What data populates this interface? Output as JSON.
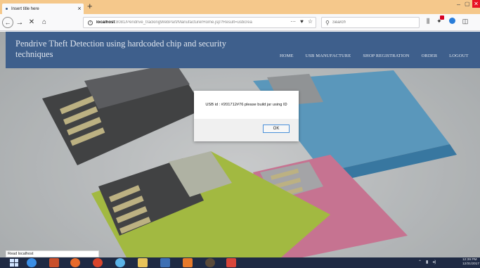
{
  "browser": {
    "tab_title": "Insert title here",
    "tab_close": "×",
    "new_tab": "+",
    "url_host": "localhost",
    "url_rest": ":8081/Pendrive_trackingWebPart/ManufacturerHome.jsp?Result=usbcrea",
    "search_placeholder": "Search",
    "page_actions": "···",
    "window_min": "–",
    "window_max": "▢",
    "window_close": "✕"
  },
  "site": {
    "title": "Pendrive Theft Detection using hardcoded chip and security techniques",
    "nav": [
      "HOME",
      "USB MANUFACTURE",
      "SHOP REGISTRATION",
      "ORDER",
      "LOGOUT"
    ]
  },
  "dialog": {
    "message": "USB id : #201712#76 please build jar using ID",
    "ok_label": "OK"
  },
  "status_text": "Read localhost",
  "taskbar": {
    "clock_time": "12:39 PM",
    "clock_date": "12/31/2017"
  },
  "colors": {
    "header_bg": "#3e5f8c",
    "titlebar_bg": "#f5c88b",
    "taskbar_bg": "#1f2a44"
  }
}
